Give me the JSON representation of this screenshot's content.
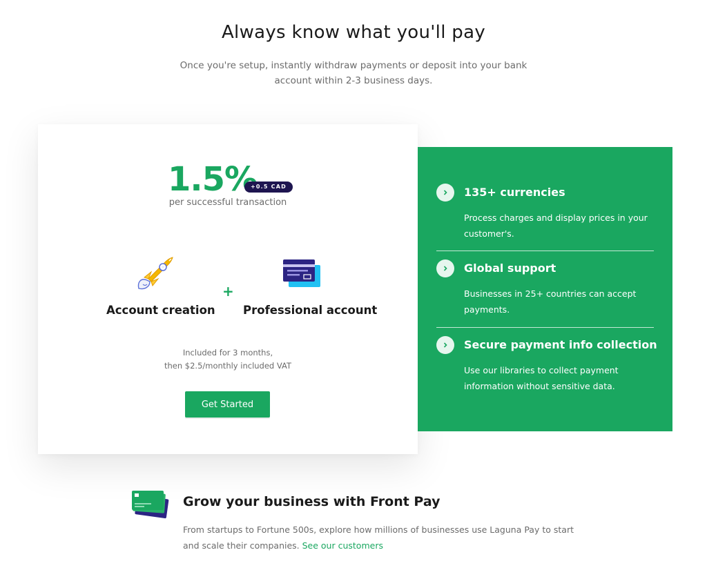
{
  "header": {
    "title": "Always know what you'll pay",
    "subtitle": "Once you're setup, instantly withdraw payments or deposit into your bank account within 2-3 business days."
  },
  "pricing": {
    "rate": "1.5%",
    "badge": "+0.5 CAD",
    "rate_caption": "per successful transaction",
    "plus": "+",
    "items": [
      {
        "label": "Account creation",
        "icon": "rocket-icon"
      },
      {
        "label": "Professional account",
        "icon": "credit-card-icon"
      }
    ],
    "note_line1": "Included for 3 months,",
    "note_line2": "then $2.5/monthly included VAT",
    "cta_label": "Get Started"
  },
  "features": [
    {
      "title": "135+ currencies",
      "description": "Process charges and display prices in your customer's.",
      "icon": "chevron-right-icon"
    },
    {
      "title": "Global support",
      "description": "Businesses in 25+ countries can accept payments.",
      "icon": "chevron-right-icon"
    },
    {
      "title": "Secure payment info collection",
      "description": "Use our libraries to collect payment information without sensitive data.",
      "icon": "chevron-right-icon"
    }
  ],
  "promo": {
    "title": "Grow your business with Front Pay",
    "text": "From startups to Fortune 500s, explore how millions of businesses use Laguna Pay to start and scale their companies.",
    "link_label": "See our customers",
    "icon": "cards-icon"
  },
  "colors": {
    "accent": "#1aa760",
    "badge_bg": "#1e1550",
    "text_dark": "#1a1a1a",
    "text_muted": "#6b6b6b"
  }
}
